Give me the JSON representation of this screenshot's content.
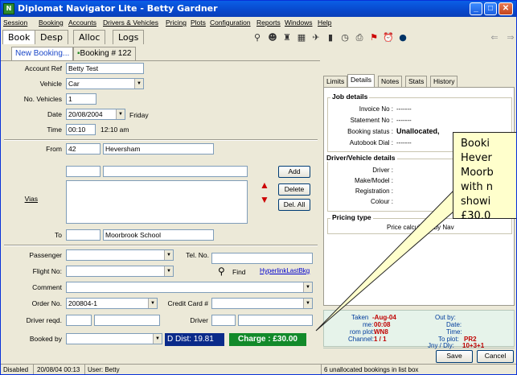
{
  "window": {
    "title": "Diplomat Navigator Lite - Betty Gardner",
    "app_icon": "navigator-app-icon"
  },
  "menu": [
    "Session",
    "Booking",
    "Accounts",
    "Drivers & Vehicles",
    "Pricing",
    "Plots",
    "Configuration",
    "Reports",
    "Windows",
    "Help"
  ],
  "top_tabs": [
    "Book",
    "Desp",
    "Alloc",
    "Logs"
  ],
  "booking_tabs": {
    "new": "New Booking...",
    "current": "Booking # 122"
  },
  "form": {
    "account_ref": {
      "label": "Account Ref",
      "value": "Betty Test"
    },
    "vehicle": {
      "label": "Vehicle",
      "value": "Car"
    },
    "no_vehicles": {
      "label": "No. Vehicles",
      "value": "1"
    },
    "date": {
      "label": "Date",
      "value": "20/08/2004",
      "day": "Friday"
    },
    "time": {
      "label": "Time",
      "value": "00:10",
      "display": "12:10 am"
    },
    "from": {
      "label": "From",
      "code": "42",
      "value": "Heversham"
    },
    "vias": {
      "label": "Vias"
    },
    "to": {
      "label": "To",
      "code": "",
      "value": "Moorbrook School"
    },
    "passenger": {
      "label": "Passenger",
      "value": ""
    },
    "tel": {
      "label": "Tel. No.",
      "value": ""
    },
    "flight": {
      "label": "Flight No:",
      "value": ""
    },
    "find_label": "Find",
    "hyperlink": "HyperlinkLastBkg",
    "comment": {
      "label": "Comment",
      "value": ""
    },
    "order": {
      "label": "Order No.",
      "value": "200804-1"
    },
    "credit_card": {
      "label": "Credit Card #",
      "value": ""
    },
    "driver_reqd": {
      "label": "Driver reqd.",
      "value": ""
    },
    "driver": {
      "label": "Driver",
      "value": ""
    },
    "booked_by": {
      "label": "Booked by",
      "value": ""
    },
    "dist": "D Dist: 19.81",
    "charge": "Charge : £30.00"
  },
  "buttons": {
    "add": "Add",
    "delete": "Delete",
    "del_all": "Del. All",
    "save": "Save",
    "cancel": "Cancel"
  },
  "right_tabs": [
    "Limits",
    "Details",
    "Notes",
    "Stats",
    "History"
  ],
  "job_details": {
    "title": "Job details",
    "invoice_label": "Invoice No :",
    "invoice_value": "-------",
    "statement_label": "Statement No :",
    "statement_value": "-------",
    "status_label": "Booking status :",
    "status_value": "Unallocated,",
    "autobook_label": "Autobook Dial :",
    "autobook_value": "-------"
  },
  "driver_details": {
    "title": "Driver/Vehicle details",
    "driver_label": "Driver :",
    "make_label": "Make/Model :",
    "reg_label": "Registration :",
    "colour_label": "Colour :"
  },
  "pricing": {
    "title": "Pricing type",
    "text": "Price calculated by Nav"
  },
  "status_box": {
    "taken_label": "Taken",
    "taken_value": "-Aug-04",
    "time_label": "me:",
    "time_value": "00:08",
    "from_plot_label": "rom plot:",
    "from_plot_value": "WN8",
    "channel_label": "Channel:",
    "channel_value": "1 / 1",
    "out_label": "Out by:",
    "date_label": "Date:",
    "time2_label": "Time:",
    "to_plot_label": "To plot:",
    "to_plot_value": "PR2",
    "jny_label": "Jny / Dly:",
    "jny_value": "10+3+1"
  },
  "statusbar": {
    "state": "Disabled",
    "datetime": "20/08/04  00:13",
    "user": "User: Betty",
    "message": "6 unallocated bookings in list box"
  },
  "callout": {
    "lines": [
      "Booki",
      "Hever",
      "Moorb",
      "with n",
      "showi",
      "£30.0"
    ]
  },
  "colors": {
    "title_bar": "#0848cc",
    "dist_bg": "#0a2a8a",
    "charge_bg": "#128a2a",
    "status_red": "#c00000",
    "callout_bg": "#ffffcc"
  }
}
